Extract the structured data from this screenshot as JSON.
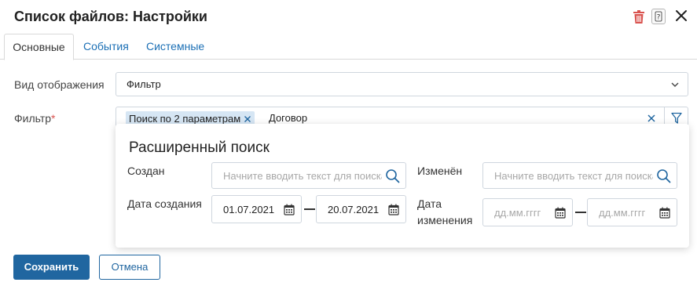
{
  "header": {
    "title": "Список файлов: Настройки",
    "delete_icon": "trash-icon",
    "help_icon": "help-icon",
    "close_icon": "close-icon",
    "delete_color": "#d9534f"
  },
  "tabs": [
    {
      "label": "Основные",
      "active": true
    },
    {
      "label": "События",
      "active": false
    },
    {
      "label": "Системные",
      "active": false
    }
  ],
  "form": {
    "view_label": "Вид отображения",
    "view_value": "Фильтр",
    "filter_label": "Фильтр",
    "filter_required_mark": "*",
    "filter_chip": "Поиск по 2 параметрам",
    "filter_text": "Договор"
  },
  "advanced_search": {
    "title": "Расширенный поиск",
    "created_label": "Создан",
    "created_placeholder": "Начните вводить текст для поиска",
    "modified_label": "Изменён",
    "modified_placeholder": "Начните вводить текст для поиска",
    "created_date_label": "Дата создания",
    "created_from": "01.07.2021",
    "created_to": "20.07.2021",
    "modified_date_label_line1": "Дата",
    "modified_date_label_line2": "изменения",
    "date_placeholder": "дд.мм.гггг"
  },
  "actions": {
    "save": "Сохранить",
    "cancel": "Отмена"
  },
  "colors": {
    "primary": "#2066a0",
    "link": "#1b6fb5",
    "chip_bg": "#d6e6f4"
  }
}
